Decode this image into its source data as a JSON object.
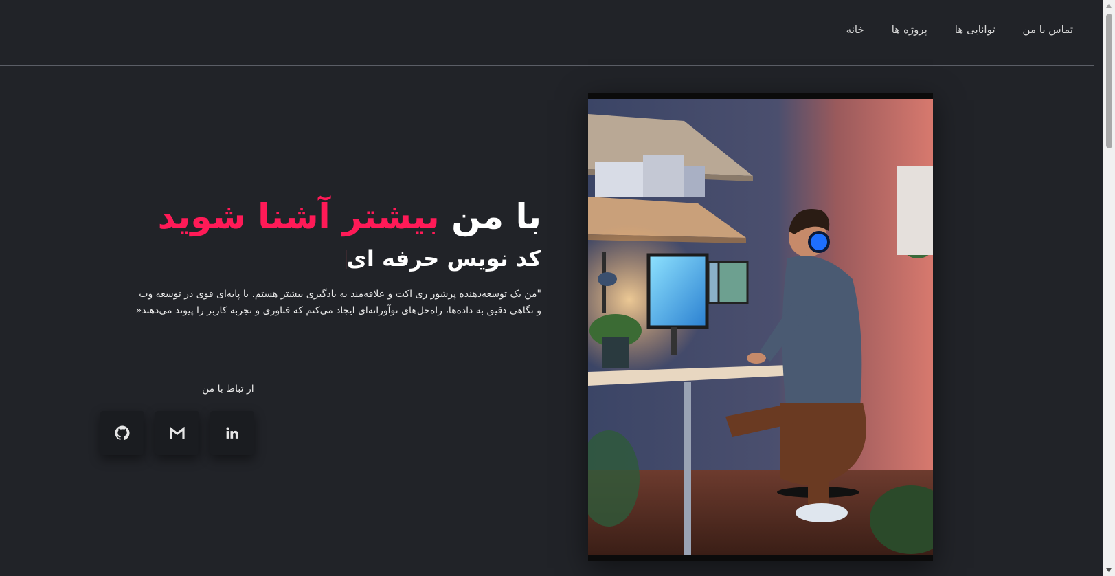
{
  "nav": {
    "items": [
      "خانه",
      "پروژه ها",
      "توانایی ها",
      "تماس با من"
    ]
  },
  "hero": {
    "title_prefix": "با من",
    "title_accent": "بیشتر آشنا شوید",
    "subtitle": "کد نویس حرفه ای",
    "description_line1": "\"من یک توسعه‌دهنده پرشور ری اکت و علاقه‌مند به یادگیری بیشتر هستم. با پایه‌ای قوی در توسعه وب",
    "description_line2": "و نگاهی دقیق به داده‌ها، راه‌حل‌های نوآورانه‌ای ایجاد می‌کنم که فناوری و تجربه کاربر را پیوند می‌دهند«"
  },
  "contact": {
    "label": "ار تباط با من",
    "links": [
      {
        "name": "github",
        "icon": "github-icon"
      },
      {
        "name": "gmail",
        "icon": "gmail-icon"
      },
      {
        "name": "linkedin",
        "icon": "linkedin-icon"
      }
    ]
  },
  "colors": {
    "background": "#212328",
    "accent": "#ff1a57",
    "text": "#ffffff",
    "button_bg": "#1a1c20"
  }
}
